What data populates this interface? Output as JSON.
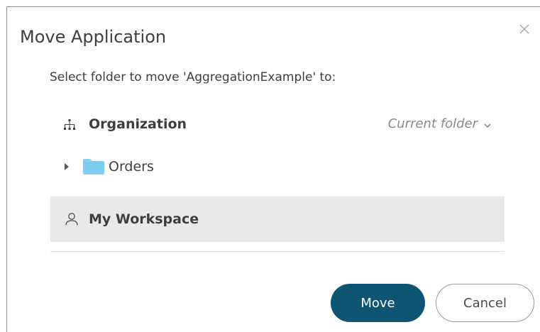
{
  "dialog": {
    "title": "Move Application",
    "prompt": "Select folder to move 'AggregationExample' to:",
    "close_icon": "close-icon"
  },
  "tree": {
    "organization": {
      "icon": "org-hierarchy-icon",
      "label": "Organization",
      "current_folder_label": "Current folder"
    },
    "orders": {
      "icon": "folder-icon",
      "label": "Orders",
      "folder_color": "#7fd0f0"
    },
    "workspace": {
      "icon": "person-icon",
      "label": "My Workspace",
      "selected": true
    }
  },
  "buttons": {
    "move_label": "Move",
    "cancel_label": "Cancel"
  },
  "colors": {
    "primary_button": "#0d5573",
    "selected_row": "#e9e9e9",
    "text": "#3e3e3e",
    "muted_text": "#8a8a8a"
  }
}
